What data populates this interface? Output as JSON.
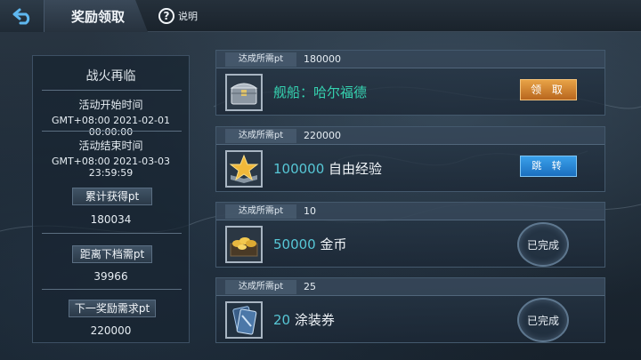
{
  "header": {
    "title": "奖励领取",
    "help_label": "说明"
  },
  "info": {
    "event_name": "战火再临",
    "start_label": "活动开始时间",
    "start_value": "GMT+08:00 2021-02-01 00:00:00",
    "end_label": "活动结束时间",
    "end_value": "GMT+08:00 2021-03-03 23:59:59",
    "earned_label": "累计获得pt",
    "earned_value": "180034",
    "next_gap_label": "距离下档需pt",
    "next_gap_value": "39966",
    "next_req_label": "下一奖励需求pt",
    "next_req_value": "220000"
  },
  "rewards": [
    {
      "req_label": "达成所需pt",
      "req_value": "180000",
      "num": "",
      "name": "舰船：哈尔福德",
      "icon": "treasure-chest-icon",
      "action": "领 取",
      "state": "claimable"
    },
    {
      "req_label": "达成所需pt",
      "req_value": "220000",
      "num": "100000",
      "name": "自由经验",
      "icon": "star-medal-icon",
      "action": "跳 转",
      "state": "locked"
    },
    {
      "req_label": "达成所需pt",
      "req_value": "10",
      "num": "50000",
      "name": "金币",
      "icon": "gold-coins-icon",
      "action": "已完成",
      "state": "completed"
    },
    {
      "req_label": "达成所需pt",
      "req_value": "25",
      "num": "20",
      "name": "涂装券",
      "icon": "camouflage-ticket-icon",
      "action": "已完成",
      "state": "completed"
    }
  ],
  "colors": {
    "claim": "#d98a33",
    "jump": "#2b8ad8",
    "reward_number": "#57c7d6",
    "ship_name": "#35d2b0"
  }
}
